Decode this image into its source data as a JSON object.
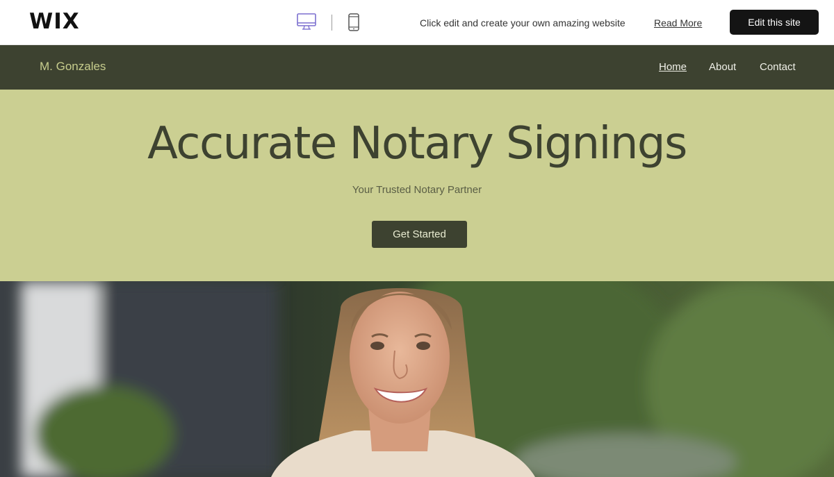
{
  "wix_bar": {
    "logo": "WIX",
    "promo_text": "Click edit and create your own amazing website",
    "read_more": "Read More",
    "edit_button": "Edit this site",
    "devices": {
      "desktop_icon": "desktop-icon",
      "mobile_icon": "mobile-icon",
      "active": "desktop"
    },
    "colors": {
      "active_device": "#7b6fcf",
      "button_bg": "#141414"
    }
  },
  "site": {
    "name": "M. Gonzales",
    "nav": [
      "Home",
      "About",
      "Contact"
    ],
    "active_nav": "Home",
    "colors": {
      "header_bg": "#3d4230",
      "name": "#c7cd8d",
      "hero_bg": "#cbcf92",
      "title": "#3d4230"
    }
  },
  "hero": {
    "title": "Accurate Notary Signings",
    "subtitle": "Your Trusted Notary Partner",
    "cta": "Get Started"
  }
}
